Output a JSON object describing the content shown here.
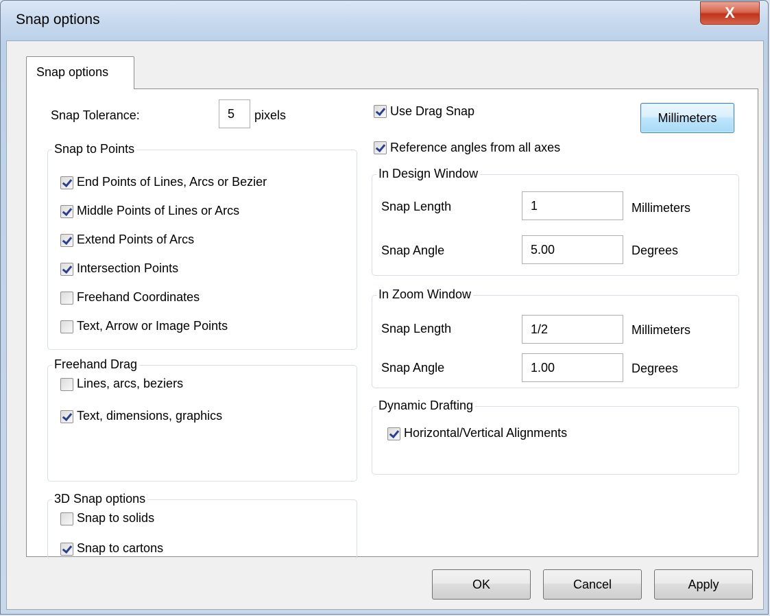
{
  "window": {
    "title": "Snap options",
    "close_label": "X"
  },
  "tab": {
    "label": "Snap options"
  },
  "tolerance": {
    "label": "Snap Tolerance:",
    "value": "5",
    "unit": "pixels"
  },
  "snap_points": {
    "title": "Snap to Points",
    "items": [
      {
        "label": "End Points of Lines, Arcs or Bezier",
        "checked": true
      },
      {
        "label": "Middle Points of Lines or Arcs",
        "checked": true
      },
      {
        "label": "Extend Points of Arcs",
        "checked": true
      },
      {
        "label": "Intersection Points",
        "checked": true
      },
      {
        "label": "Freehand Coordinates",
        "checked": false
      },
      {
        "label": "Text, Arrow or Image Points",
        "checked": false
      }
    ]
  },
  "freehand": {
    "title": "Freehand Drag",
    "items": [
      {
        "label": "Lines, arcs, beziers",
        "checked": false
      },
      {
        "label": "Text, dimensions, graphics",
        "checked": true
      }
    ]
  },
  "snap3d": {
    "title": "3D Snap options",
    "items": [
      {
        "label": "Snap to solids",
        "checked": false
      },
      {
        "label": "Snap to cartons",
        "checked": true
      }
    ]
  },
  "drag": {
    "use_drag_snap": {
      "label": "Use Drag Snap",
      "checked": true
    },
    "reference_angles": {
      "label": "Reference angles from all axes",
      "checked": true
    },
    "units_button": "Millimeters"
  },
  "design_window": {
    "title": "In Design Window",
    "length_label": "Snap Length",
    "length_value": "1",
    "length_unit": "Millimeters",
    "angle_label": "Snap Angle",
    "angle_value": "5.00",
    "angle_unit": "Degrees"
  },
  "zoom_window": {
    "title": "In Zoom Window",
    "length_label": "Snap Length",
    "length_value": "1/2",
    "length_unit": "Millimeters",
    "angle_label": "Snap Angle",
    "angle_value": "1.00",
    "angle_unit": "Degrees"
  },
  "dynamic": {
    "title": "Dynamic Drafting",
    "items": [
      {
        "label": "Horizontal/Vertical Alignments",
        "checked": true
      }
    ]
  },
  "buttons": {
    "ok": "OK",
    "cancel": "Cancel",
    "apply": "Apply"
  }
}
